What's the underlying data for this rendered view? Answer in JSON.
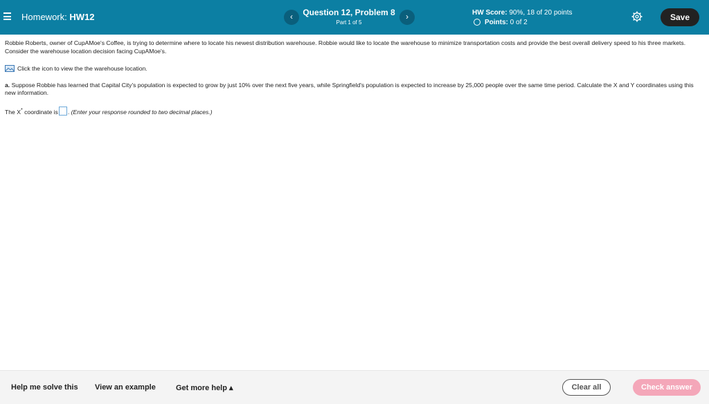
{
  "header": {
    "homework_prefix": "Homework:",
    "homework_name": "HW12",
    "question_title": "Question 12, Problem 8",
    "part_label": "Part 1 of 5",
    "prev_symbol": "‹",
    "next_symbol": "›",
    "hw_score_label": "HW Score:",
    "hw_score_value": "90%, 18 of 20 points",
    "points_label": "Points:",
    "points_value": "0 of 2",
    "save_label": "Save",
    "colors": {
      "bar": "#0c7fa3",
      "save_bg": "#222222"
    }
  },
  "problem": {
    "intro": "Robbie Roberts, owner of CupAMoe's Coffee, is trying to determine where to locate his newest distribution warehouse. Robbie would like to locate the warehouse to minimize transportation costs and provide the best overall delivery speed to his three markets. Consider the warehouse location decision facing CupAMoe's.",
    "icon_link_text": "Click the icon to view the the warehouse location.",
    "part_a_label": "a.",
    "part_a_text": "Suppose Robbie has learned that Capital City's population is expected to grow by just 10% over the next five years, while Springfield's population is expected to increase by 25,000 people over the same time period. Calculate the X and Y coordinates using this new information.",
    "x_line_prefix": "The X",
    "x_superscript": "*",
    "x_line_mid": "coordinate is",
    "x_answer_value": "",
    "x_line_hint": "(Enter your response rounded to two decimal places.)"
  },
  "footer": {
    "help_solve": "Help me solve this",
    "view_example": "View an example",
    "more_help": "Get more help ▴",
    "clear_all": "Clear all",
    "check_answer": "Check answer",
    "colors": {
      "check_bg": "#f4a7b9"
    }
  }
}
